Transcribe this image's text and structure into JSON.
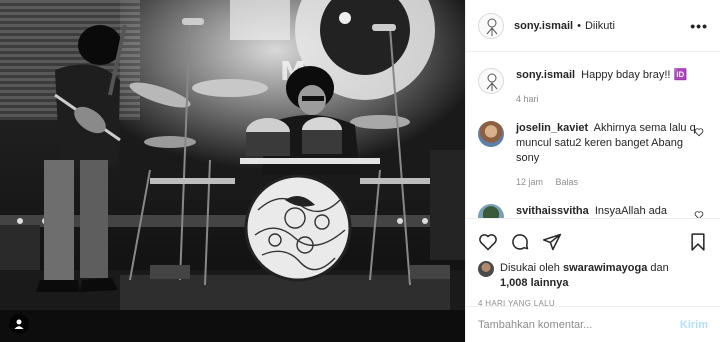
{
  "post": {
    "author": "sony.ismail",
    "follow_status": "Diikuti",
    "separator": "•",
    "more_label": "•••"
  },
  "comments": [
    {
      "user": "sony.ismail",
      "text": "Happy bday bray!! 🆔",
      "time": "4 hari",
      "reply": "",
      "avatar": "sketch-avatar"
    },
    {
      "user": "joselin_kaviet",
      "text": "Akhirnya sema lalu q muncul satu2 keren banget Abang sony",
      "time": "12 jam",
      "reply": "Balas",
      "avatar": "photo-avatar"
    },
    {
      "user": "svithaissvitha",
      "text": "InsyaAllah ada",
      "time": "",
      "reply": "",
      "avatar": "photo-avatar"
    }
  ],
  "likes": {
    "prefix": "Disukai oleh",
    "user": "swarawimayoga",
    "joiner": "dan",
    "others": "1,008 lainnya"
  },
  "timestamp": "4 HARI YANG LALU",
  "comment_input": {
    "placeholder": "Tambahkan komentar...",
    "post_label": "Kirim"
  },
  "icons": {
    "like": "heart-icon",
    "comment": "comment-icon",
    "share": "paper-plane-icon",
    "save": "bookmark-icon",
    "tag": "user-tag-icon"
  },
  "colors": {
    "post_button": "#b2dffc",
    "muted_text": "#8e8e8e",
    "primary_text": "#262626"
  }
}
